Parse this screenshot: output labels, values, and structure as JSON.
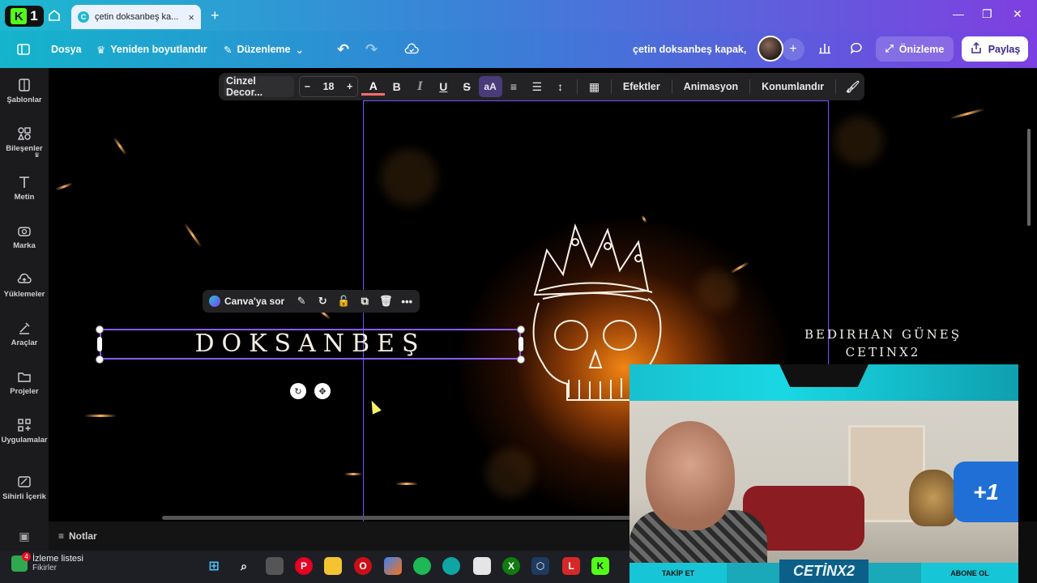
{
  "browser": {
    "tab_title": "çetin doksanbeş ka...",
    "tab_close": "×",
    "new_tab": "+",
    "window_controls": [
      "—",
      "❐",
      "✕"
    ]
  },
  "toolbar": {
    "file": "Dosya",
    "resize": "Yeniden boyutlandır",
    "edit": "Düzenleme",
    "design_name": "çetin doksanbeş kapak,",
    "preview": "Önizleme",
    "share": "Paylaş"
  },
  "sidebar": {
    "items": [
      {
        "label": "Şablonlar",
        "icon": "templates-icon"
      },
      {
        "label": "Bileşenler",
        "icon": "elements-icon"
      },
      {
        "label": "Metin",
        "icon": "text-icon"
      },
      {
        "label": "Marka",
        "icon": "brand-icon"
      },
      {
        "label": "Yüklemeler",
        "icon": "uploads-icon"
      },
      {
        "label": "Araçlar",
        "icon": "tools-icon"
      },
      {
        "label": "Projeler",
        "icon": "projects-icon"
      },
      {
        "label": "Uygulamalar",
        "icon": "apps-icon"
      },
      {
        "label": "Sihirli İçerik",
        "icon": "magic-media-icon"
      }
    ]
  },
  "text_toolbar": {
    "font": "Cinzel Decor...",
    "minus": "−",
    "size": "18",
    "plus": "+",
    "effects": "Efektler",
    "animation": "Animasyon",
    "position": "Konumlandır"
  },
  "mini_toolbar": {
    "ask": "Canva'ya sor",
    "more": "•••"
  },
  "canvas": {
    "headline": "DOKSANBEŞ",
    "name_line1": "BEDIRHAN GÜNEŞ",
    "name_line2": "CETINX2"
  },
  "notes": {
    "label": "Notlar"
  },
  "webcam": {
    "follow": "TAKİP ET",
    "brand": "CETİNX2",
    "subscribe": "ABONE OL",
    "plus_one": "+1"
  },
  "taskbar": {
    "watchlist_title": "İzleme listesi",
    "watchlist_sub": "Fikirler",
    "badge": "4",
    "apps": [
      "windows-start",
      "search",
      "task-view",
      "pinterest",
      "file-explorer",
      "opera",
      "copilot",
      "spotify",
      "edge",
      "notepad",
      "xbox",
      "app-hex",
      "app-l",
      "kick"
    ]
  },
  "colors": {
    "accent_purple": "#7c4dff",
    "gradient_left": "#14b4cc",
    "gradient_right": "#7b3fe2",
    "glow_orange": "#ff8c14"
  }
}
